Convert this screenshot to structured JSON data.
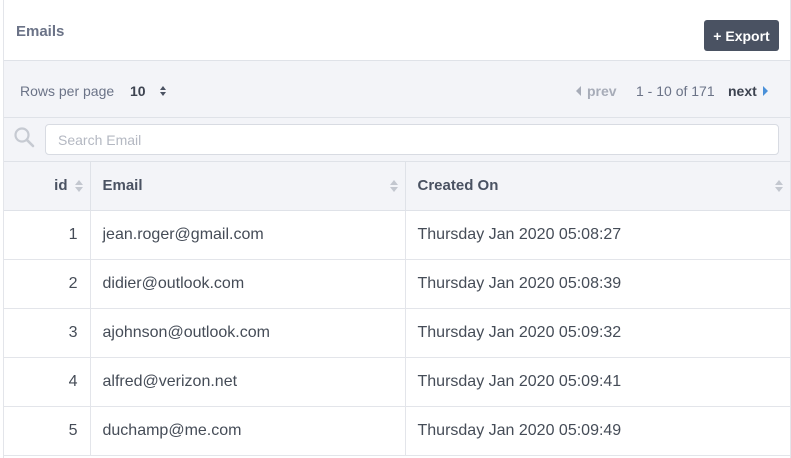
{
  "header": {
    "title": "Emails",
    "export_label": "+ Export"
  },
  "pager": {
    "rows_per_page_label": "Rows per page",
    "rows_per_page_value": "10",
    "prev_label": "prev",
    "page_info": "1 - 10 of 171",
    "next_label": "next"
  },
  "search": {
    "placeholder": "Search Email",
    "value": ""
  },
  "table": {
    "columns": [
      "id",
      "Email",
      "Created On"
    ],
    "rows": [
      {
        "id": "1",
        "email": "jean.roger@gmail.com",
        "created_on": "Thursday Jan 2020 05:08:27"
      },
      {
        "id": "2",
        "email": "didier@outlook.com",
        "created_on": "Thursday Jan 2020 05:08:39"
      },
      {
        "id": "3",
        "email": "ajohnson@outlook.com",
        "created_on": "Thursday Jan 2020 05:09:32"
      },
      {
        "id": "4",
        "email": "alfred@verizon.net",
        "created_on": "Thursday Jan 2020 05:09:41"
      },
      {
        "id": "5",
        "email": "duchamp@me.com",
        "created_on": "Thursday Jan 2020 05:09:49"
      }
    ]
  },
  "colors": {
    "export_button_bg": "#4a5262",
    "toolbar_bg": "#f3f4f8",
    "next_arrow": "#4a90d9",
    "prev_disabled": "#a7acb8"
  },
  "icons": {
    "search": "search-icon",
    "sort": "sort-icon",
    "prev": "caret-left-icon",
    "next": "caret-right-icon",
    "select": "select-updown-icon"
  }
}
